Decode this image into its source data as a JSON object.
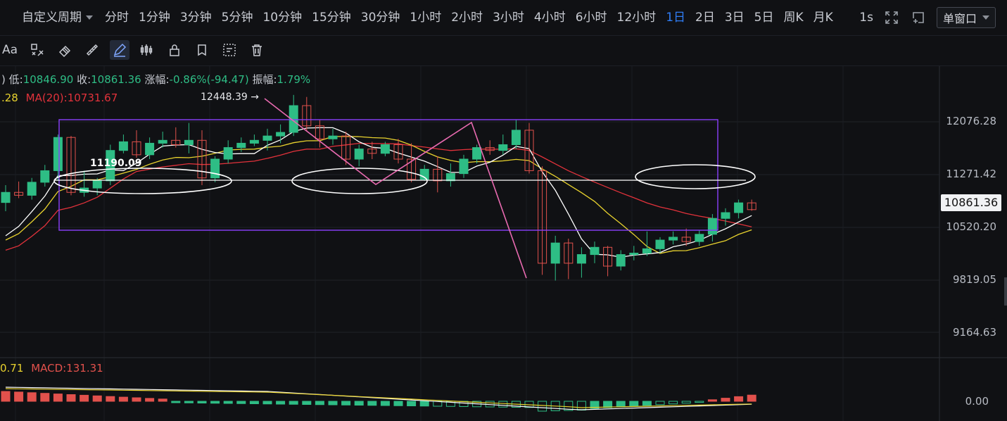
{
  "toolbar": {
    "custom_period": "自定义周期",
    "periods": [
      "分时",
      "1分钟",
      "3分钟",
      "5分钟",
      "10分钟",
      "15分钟",
      "30分钟",
      "1小时",
      "2小时",
      "3小时",
      "4小时",
      "6小时",
      "12小时",
      "1日",
      "2日",
      "3日",
      "5日",
      "周K",
      "月K"
    ],
    "active_period": "1日",
    "interval_label": "1s",
    "window_mode": "单窗口"
  },
  "drawing_tools": {
    "text_tool": "Aa",
    "icons": [
      "text-tool-icon",
      "ruler-icon",
      "eraser-icon",
      "measure-icon",
      "pencil-icon",
      "candle-icon",
      "lock-icon",
      "copy-icon",
      "layout-icon",
      "trash-icon"
    ]
  },
  "ohlc": {
    "low_label": "低:",
    "low": "10846.90",
    "close_label": "收:",
    "close": "10861.36",
    "change_label": "涨幅:",
    "change": "-0.86%(-94.47)",
    "amplitude_label": "振幅:",
    "amplitude": "1.79%"
  },
  "ma": {
    "partial": ".28",
    "ma20": "MA(20):10731.67"
  },
  "macd": {
    "partial": "0.71",
    "label": "MACD:131.31"
  },
  "annotations": {
    "high_marker": "12448.39 →",
    "level_label": "11190.09"
  },
  "colors": {
    "up": "#2ebd85",
    "down": "#e2514c",
    "ma_short": "#ffffff",
    "ma_mid": "#e8d22e",
    "ma20": "#e2323b",
    "box": "#8a3ffc",
    "zigzag": "#e86ab0"
  },
  "chart_data": {
    "type": "candlestick",
    "y_axis_ticks": [
      "12076.28",
      "11271.42",
      "10520.20",
      "9819.05",
      "9164.63"
    ],
    "last_price": "10861.36",
    "macd_axis_tick": "0.00",
    "candles": [
      {
        "o": 10960,
        "h": 11200,
        "l": 10840,
        "c": 11100
      },
      {
        "o": 11100,
        "h": 11250,
        "l": 11020,
        "c": 11060
      },
      {
        "o": 11060,
        "h": 11300,
        "l": 11000,
        "c": 11240
      },
      {
        "o": 11240,
        "h": 11480,
        "l": 11180,
        "c": 11400
      },
      {
        "o": 11400,
        "h": 11900,
        "l": 11260,
        "c": 11860
      },
      {
        "o": 11860,
        "h": 11880,
        "l": 11060,
        "c": 11100
      },
      {
        "o": 11100,
        "h": 11400,
        "l": 11040,
        "c": 11160
      },
      {
        "o": 11160,
        "h": 11300,
        "l": 11060,
        "c": 11260
      },
      {
        "o": 11260,
        "h": 11760,
        "l": 11200,
        "c": 11680
      },
      {
        "o": 11680,
        "h": 11900,
        "l": 11640,
        "c": 11800
      },
      {
        "o": 11800,
        "h": 11960,
        "l": 11580,
        "c": 11620
      },
      {
        "o": 11620,
        "h": 11860,
        "l": 11560,
        "c": 11780
      },
      {
        "o": 11780,
        "h": 11940,
        "l": 11720,
        "c": 11820
      },
      {
        "o": 11820,
        "h": 12000,
        "l": 11720,
        "c": 11760
      },
      {
        "o": 11760,
        "h": 12060,
        "l": 11640,
        "c": 11820
      },
      {
        "o": 11820,
        "h": 11960,
        "l": 11200,
        "c": 11300
      },
      {
        "o": 11300,
        "h": 11600,
        "l": 11240,
        "c": 11560
      },
      {
        "o": 11560,
        "h": 11820,
        "l": 11500,
        "c": 11720
      },
      {
        "o": 11720,
        "h": 11860,
        "l": 11660,
        "c": 11780
      },
      {
        "o": 11780,
        "h": 11900,
        "l": 11740,
        "c": 11820
      },
      {
        "o": 11820,
        "h": 11980,
        "l": 11680,
        "c": 11880
      },
      {
        "o": 11880,
        "h": 12040,
        "l": 11780,
        "c": 11930
      },
      {
        "o": 11930,
        "h": 12448,
        "l": 11880,
        "c": 12300
      },
      {
        "o": 12300,
        "h": 12420,
        "l": 11950,
        "c": 12020
      },
      {
        "o": 12020,
        "h": 12100,
        "l": 11720,
        "c": 11840
      },
      {
        "o": 11840,
        "h": 11980,
        "l": 11760,
        "c": 11880
      },
      {
        "o": 11880,
        "h": 11940,
        "l": 11480,
        "c": 11560
      },
      {
        "o": 11560,
        "h": 11760,
        "l": 11460,
        "c": 11700
      },
      {
        "o": 11700,
        "h": 11800,
        "l": 11560,
        "c": 11640
      },
      {
        "o": 11640,
        "h": 11800,
        "l": 11600,
        "c": 11760
      },
      {
        "o": 11760,
        "h": 11840,
        "l": 11500,
        "c": 11560
      },
      {
        "o": 11560,
        "h": 11780,
        "l": 11240,
        "c": 11280
      },
      {
        "o": 11280,
        "h": 11480,
        "l": 11260,
        "c": 11420
      },
      {
        "o": 11420,
        "h": 11600,
        "l": 11100,
        "c": 11260
      },
      {
        "o": 11260,
        "h": 11500,
        "l": 11180,
        "c": 11360
      },
      {
        "o": 11360,
        "h": 11620,
        "l": 11300,
        "c": 11560
      },
      {
        "o": 11560,
        "h": 11760,
        "l": 11500,
        "c": 11720
      },
      {
        "o": 11720,
        "h": 11820,
        "l": 11620,
        "c": 11680
      },
      {
        "o": 11680,
        "h": 11900,
        "l": 11620,
        "c": 11760
      },
      {
        "o": 11760,
        "h": 12100,
        "l": 11700,
        "c": 11960
      },
      {
        "o": 11960,
        "h": 12060,
        "l": 11360,
        "c": 11400
      },
      {
        "o": 11400,
        "h": 11460,
        "l": 9960,
        "c": 10120
      },
      {
        "o": 10120,
        "h": 10500,
        "l": 9880,
        "c": 10400
      },
      {
        "o": 10400,
        "h": 10460,
        "l": 9900,
        "c": 10120
      },
      {
        "o": 10120,
        "h": 10340,
        "l": 9920,
        "c": 10240
      },
      {
        "o": 10240,
        "h": 10420,
        "l": 10120,
        "c": 10340
      },
      {
        "o": 10340,
        "h": 10360,
        "l": 9940,
        "c": 10080
      },
      {
        "o": 10080,
        "h": 10300,
        "l": 10020,
        "c": 10240
      },
      {
        "o": 10240,
        "h": 10360,
        "l": 10160,
        "c": 10260
      },
      {
        "o": 10260,
        "h": 10560,
        "l": 10220,
        "c": 10320
      },
      {
        "o": 10320,
        "h": 10480,
        "l": 10260,
        "c": 10440
      },
      {
        "o": 10440,
        "h": 10560,
        "l": 10380,
        "c": 10480
      },
      {
        "o": 10480,
        "h": 10600,
        "l": 10360,
        "c": 10420
      },
      {
        "o": 10420,
        "h": 10580,
        "l": 10360,
        "c": 10520
      },
      {
        "o": 10520,
        "h": 10800,
        "l": 10420,
        "c": 10740
      },
      {
        "o": 10740,
        "h": 10880,
        "l": 10640,
        "c": 10820
      },
      {
        "o": 10820,
        "h": 11000,
        "l": 10740,
        "c": 10955
      },
      {
        "o": 10955,
        "h": 11000,
        "l": 10846,
        "c": 10861
      }
    ]
  }
}
